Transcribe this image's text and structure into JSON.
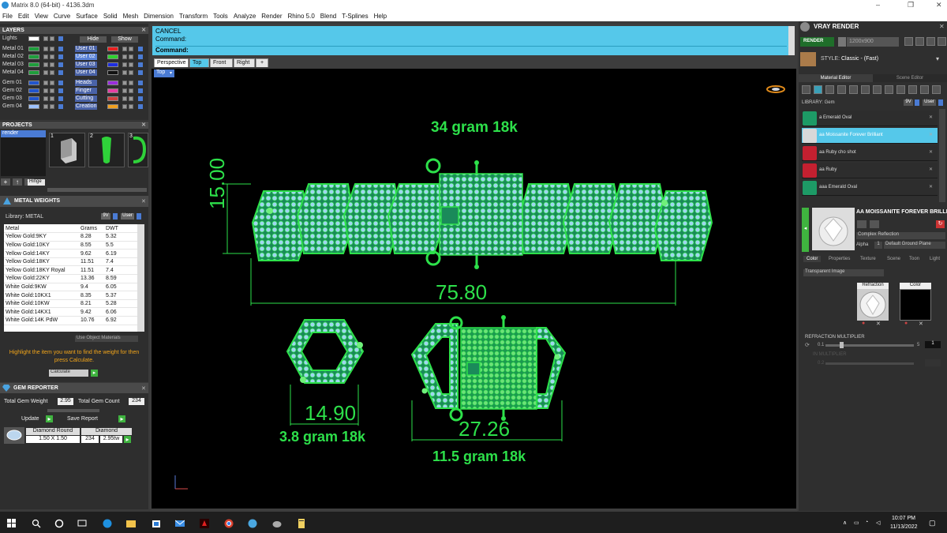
{
  "window": {
    "title": "Matrix 8.0 (64-bit) - 4136.3dm",
    "min": "–",
    "max": "❐",
    "close": "✕"
  },
  "menu": [
    "File",
    "Edit",
    "View",
    "Curve",
    "Surface",
    "Solid",
    "Mesh",
    "Dimension",
    "Transform",
    "Tools",
    "Analyze",
    "Render",
    "Rhino 5.0",
    "Blend",
    "T-Splines",
    "Help"
  ],
  "layers": {
    "title": "LAYERS",
    "hide_label": "Hide",
    "show_label": "Show",
    "lights": "Lights",
    "left_items": [
      {
        "name": "Metal 01",
        "color": "#1f9e3c"
      },
      {
        "name": "Metal 02",
        "color": "#1f9e3c"
      },
      {
        "name": "Metal 03",
        "color": "#1f9e3c"
      },
      {
        "name": "Metal 04",
        "color": "#1f9e3c"
      },
      {
        "name": "Gem 01",
        "color": "#2255cc"
      },
      {
        "name": "Gem 02",
        "color": "#2255cc"
      },
      {
        "name": "Gem 03",
        "color": "#2255cc"
      },
      {
        "name": "Gem 04",
        "color": "#9ec3ff"
      }
    ],
    "right_items": [
      {
        "name": "User 01",
        "color": "#e82020"
      },
      {
        "name": "User 02",
        "color": "#2ed22e"
      },
      {
        "name": "User 03",
        "color": "#1e2ee0"
      },
      {
        "name": "User 04",
        "color": "#111111"
      },
      {
        "name": "Heads",
        "color": "#9a2edc"
      },
      {
        "name": "Finger",
        "color": "#e63fa4"
      },
      {
        "name": "Cutting",
        "color": "#d04040"
      },
      {
        "name": "Creation",
        "color": "#f0a020"
      }
    ]
  },
  "projects": {
    "title": "PROJECTS",
    "item": "render",
    "thumb_nums": [
      "1",
      "2",
      "3"
    ],
    "hinge": "Hinge",
    "plus": "+"
  },
  "metal_weights": {
    "title": "METAL WEIGHTS",
    "library_label": "Library: METAL",
    "lib_btn1": "9V",
    "lib_btn2": "User",
    "columns": [
      "Metal",
      "Grams",
      "DWT"
    ],
    "rows": [
      [
        "Yellow Gold:9KY",
        "8.28",
        "5.32"
      ],
      [
        "Yellow Gold:10KY",
        "8.55",
        "5.5"
      ],
      [
        "Yellow Gold:14KY",
        "9.62",
        "6.19"
      ],
      [
        "Yellow Gold:18KY",
        "11.51",
        "7.4"
      ],
      [
        "Yellow Gold:18KY Royal",
        "11.51",
        "7.4"
      ],
      [
        "Yellow Gold:22KY",
        "13.36",
        "8.59"
      ],
      [
        "White Gold:9KW",
        "9.4",
        "6.05"
      ],
      [
        "White Gold:10KX1",
        "8.35",
        "5.37"
      ],
      [
        "White Gold:10KW",
        "8.21",
        "5.28"
      ],
      [
        "White Gold:14KX1",
        "9.42",
        "6.06"
      ],
      [
        "White Gold:14K PdW",
        "10.76",
        "6.92"
      ]
    ],
    "use_object": "Use Object Materials",
    "hint": "Highlight the item you want to find the weight for then press Calculate.",
    "calculate": "Calculate"
  },
  "gem_reporter": {
    "title": "GEM REPORTER",
    "total_weight_label": "Total Gem Weight",
    "total_weight": "2.95",
    "total_count_label": "Total Gem Count",
    "total_count": "234",
    "update": "Update",
    "save_report": "Save Report",
    "col_shape": "Diamond Round",
    "col_type": "Diamond",
    "size": "1.50 X 1.50",
    "count": "234",
    "ctw": "2.95tw"
  },
  "command": {
    "cancel": "CANCEL",
    "line1": "Command:",
    "line2": "Command:"
  },
  "view_tabs": [
    "Perspective",
    "Top",
    "Front",
    "Right"
  ],
  "view_plus": "+",
  "viewport": {
    "label": "Top",
    "annotations": {
      "top_weight": "34 gram 18k",
      "height_dim": "15.00",
      "width_dim": "75.80",
      "link_dim": "14.90",
      "link_weight": "3.8 gram 18k",
      "clasp_dim": "27.26",
      "clasp_weight": "11.5 gram 18k"
    },
    "accent": "#2de04a",
    "stone": "#9fd6ef"
  },
  "vray": {
    "title": "VRAY RENDER",
    "render": "RENDER",
    "resolution": "1200x900",
    "style_label": "STYLE:",
    "style_value": "Classic - (Fast)",
    "tabs": [
      "Material Editor",
      "Scene Editor"
    ],
    "library": "LIBRARY: Gem",
    "lib_btn1": "9V",
    "lib_btn2": "User",
    "materials": [
      {
        "name": "a Emerald Oval",
        "color": "#1d9a66"
      },
      {
        "name": "aa Moissanite Forever Brilliant",
        "color": "#d8d8d8"
      },
      {
        "name": "aa Ruby cho shot",
        "color": "#c42030"
      },
      {
        "name": "aa Ruby",
        "color": "#c42030"
      },
      {
        "name": "aaa Emerald Oval",
        "color": "#1d9a66"
      }
    ],
    "selected_material": "AA MOISSANITE FOREVER BRILLIANT",
    "reflection": "Complex Reflection",
    "alpha_label": "Alpha",
    "alpha_value": "1",
    "ground": "Default Ground Plane",
    "prop_tabs": [
      "Color",
      "Properties",
      "Texture",
      "Scene",
      "Toon",
      "Light"
    ],
    "transparent": "Transparent Image",
    "refraction": "Refraction",
    "color": "Color",
    "refr_mult": "REFRACTION MULTIPLIER",
    "slider_min": "0.1",
    "slider_max": "5",
    "slider_val": "1",
    "thickness": "IN MULTIPLIER",
    "slider2_min": "0.2"
  },
  "taskbar": {
    "time": "10:07 PM",
    "date": "11/13/2022"
  }
}
